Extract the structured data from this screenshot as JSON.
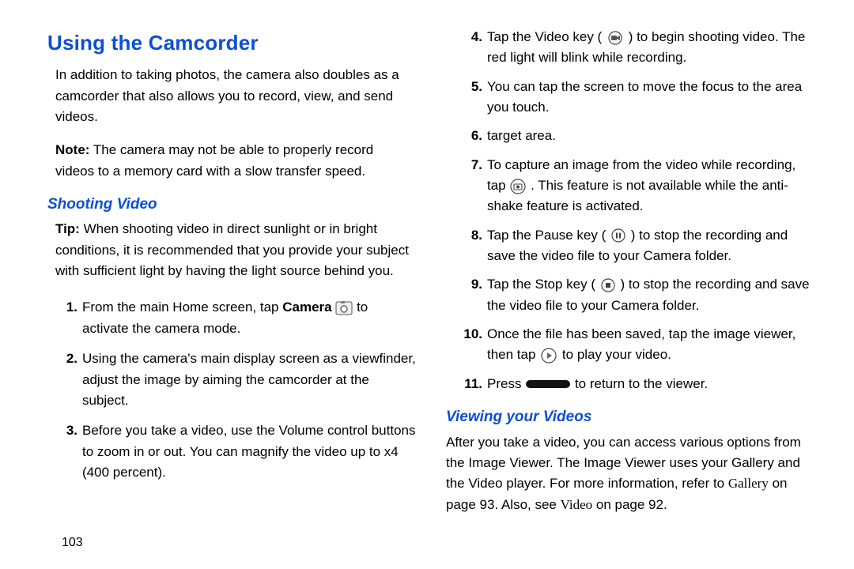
{
  "heading": "Using the Camcorder",
  "intro": "In addition to taking photos, the camera also doubles as a camcorder that also allows you to record, view, and send videos.",
  "note_label": "Note:",
  "note_body": " The camera may not be able to properly record videos to a memory card with a slow transfer speed.",
  "sub1": "Shooting Video",
  "tip_label": "Tip:",
  "tip_body": " When shooting video in direct sunlight or in bright conditions, it is recommended that you provide your subject with sufficient light by having the light source behind you.",
  "steps_left": [
    {
      "n": "1.",
      "pre": "From the main Home screen, tap ",
      "bold": "Camera",
      "post": "  to activate the camera mode."
    },
    {
      "n": "2.",
      "pre": "Using the camera's main display screen as a viewfinder, adjust the image by aiming the camcorder at the subject.",
      "bold": "",
      "post": ""
    },
    {
      "n": "3.",
      "pre": "Before you take a video, use the Volume control buttons to zoom in or out. You can magnify the video up to x4 (400 percent).",
      "bold": "",
      "post": ""
    }
  ],
  "steps_right": [
    {
      "n": "4.",
      "a": "Tap the Video key (",
      "b": ") to begin shooting video. The red light will blink while recording."
    },
    {
      "n": "5.",
      "a": "You can tap the screen to move the focus to the area you touch.",
      "b": ""
    },
    {
      "n": "6.",
      "a": "target area.",
      "b": ""
    },
    {
      "n": "7.",
      "a": "To capture an image from the video while recording, tap",
      "b": ". This feature is not available while the anti-shake feature is activated."
    },
    {
      "n": "8.",
      "a": "Tap the Pause key (",
      "b": ") to stop the recording and save the video file to your Camera folder."
    },
    {
      "n": "9.",
      "a": "Tap the Stop key (",
      "b": ") to stop the recording and save the video file to your Camera folder."
    },
    {
      "n": "10.",
      "a": "Once the file has been saved, tap the image viewer, then tap",
      "b": " to play your video."
    },
    {
      "n": "11.",
      "a": "Press",
      "b": " to return to the viewer."
    }
  ],
  "sub2": "Viewing your Videos",
  "viewing_a": "After you take a video, you can access various options from the Image Viewer. The Image Viewer uses your Gallery and the Video player. For more information, refer to ",
  "viewing_gallery": "Gallery",
  "viewing_b": " on page 93. Also, see ",
  "viewing_video": "Video",
  "viewing_c": " on page 92.",
  "page_number": "103"
}
